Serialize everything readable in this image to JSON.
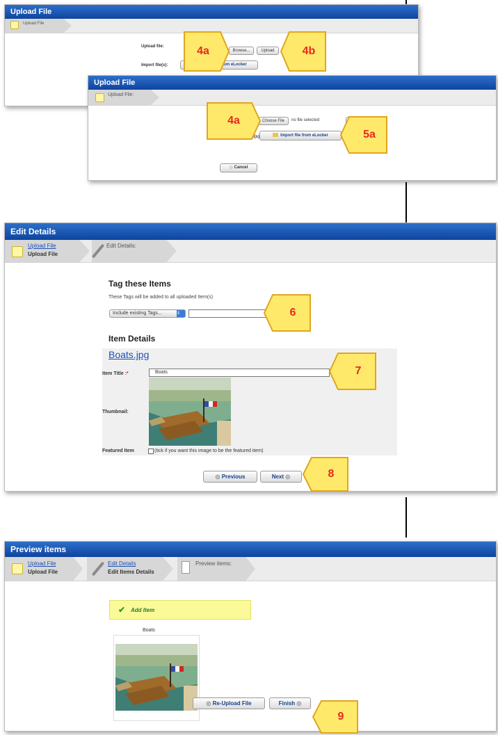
{
  "panel1": {
    "title": "Upload File",
    "crumb": "Upload File",
    "upload_label": "Upload file:",
    "browse_button": "Browse...",
    "upload_button": "Upload",
    "import_label": "Import file(s):",
    "import_button": "Import file from eLocker"
  },
  "panel2": {
    "title": "Upload File",
    "crumb": "Upload File:",
    "choose_button": "Choose File",
    "no_file_text": "no file selected",
    "upload_button": "Up",
    "import_label": "file(s):",
    "import_label_prefix": "Im",
    "import_button": "Import file from eLocker",
    "cancel_button": "Cancel"
  },
  "panel3": {
    "title": "Edit Details",
    "crumb1_link": "Upload File",
    "crumb1_sub": "Upload File",
    "crumb2": "Edit Details:",
    "tag_heading": "Tag these Items",
    "tag_note": "These Tags will be added to all uploaded Item(s)",
    "tag_select": "Include existing Tags...",
    "tag_input": "",
    "item_details_heading": "Item Details",
    "file_link": "Boats.jpg",
    "item_title_label": "Item Title",
    "item_title_required": ":*",
    "item_title_value": "Boats",
    "thumbnail_label": "Thumbnail:",
    "featured_label": "Featured Item",
    "featured_hint": "(tick if you want this image to be the featured item)",
    "previous_button": "Previous",
    "next_button": "Next"
  },
  "panel4": {
    "title": "Preview items",
    "crumb1_link": "Upload File",
    "crumb1_sub": "Upload File",
    "crumb2_link": "Edit Details",
    "crumb2_sub": "Edit Items Details",
    "crumb3": "Preview items:",
    "add_item": "Add Item",
    "caption": "Boats",
    "reupload_button": "Re-Upload File",
    "finish_button": "Finish"
  },
  "callouts": {
    "c4a_top": "4a",
    "c4b": "4b",
    "c4a_mid": "4a",
    "c5a": "5a",
    "c6": "6",
    "c7": "7",
    "c8": "8",
    "c9": "9"
  },
  "colors": {
    "titlebar": "#1450a8",
    "callout_fill": "#ffe96b",
    "callout_text": "#e7281f",
    "add_item_bg": "#fbfa99",
    "link": "#1a4fb8"
  }
}
